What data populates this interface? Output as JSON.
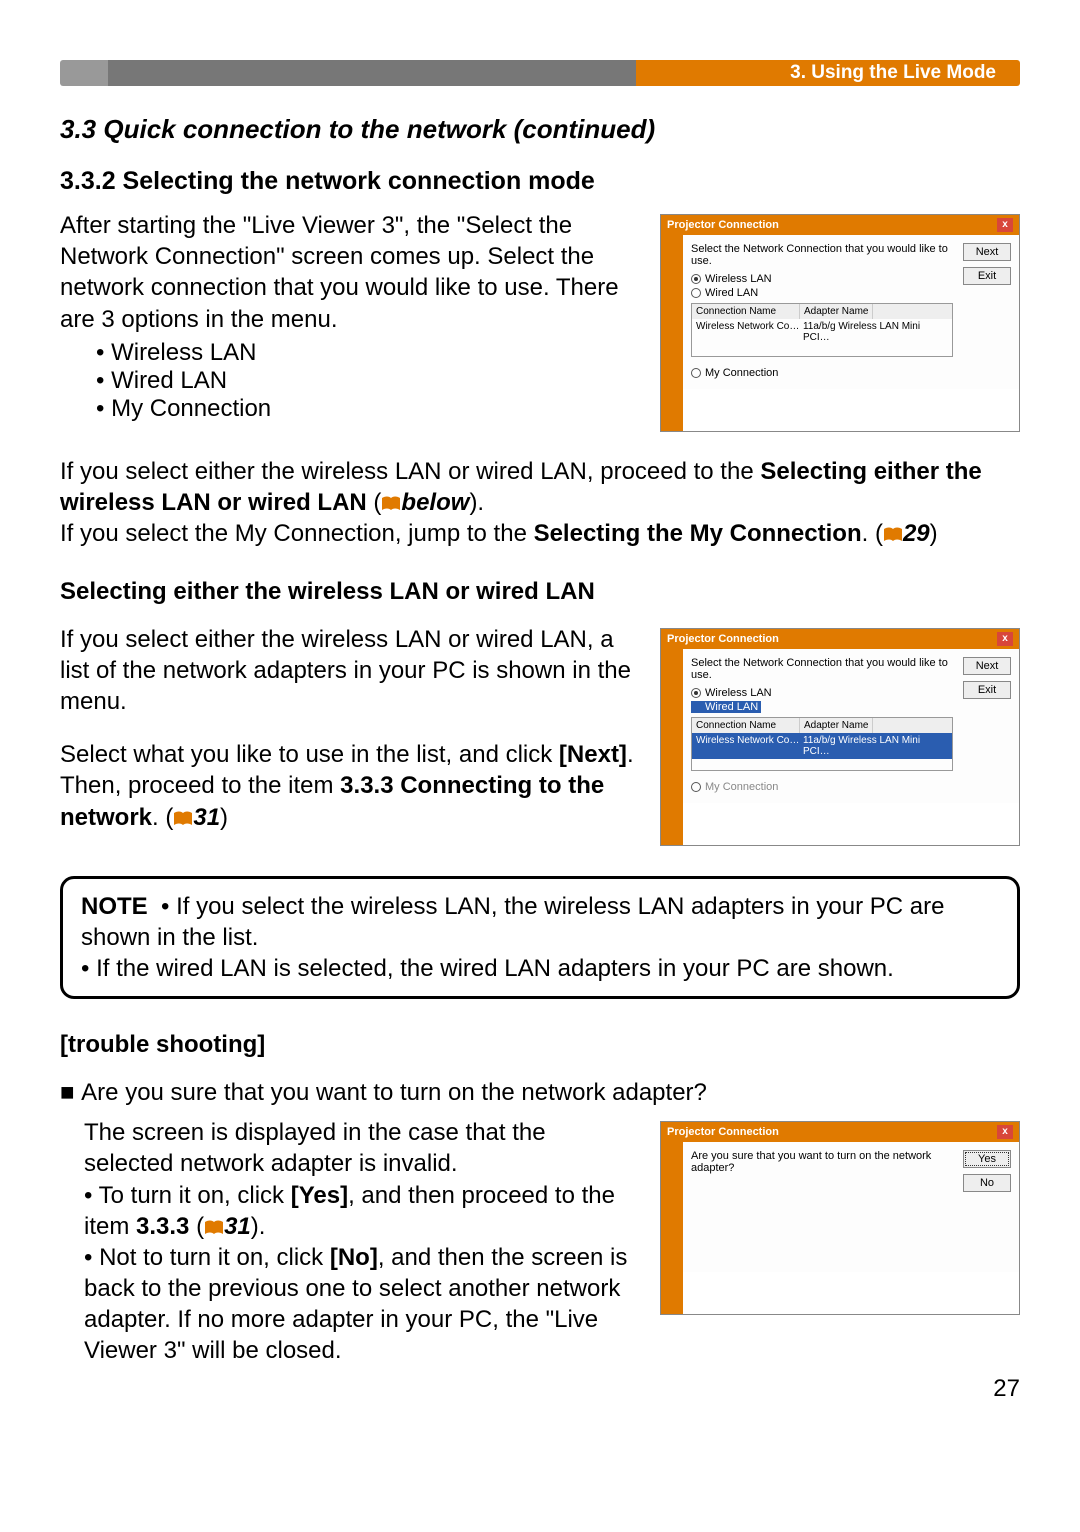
{
  "breadcrumb": "3. Using the Live Mode",
  "section": "3.3 Quick connection to the network (continued)",
  "subsection": "3.3.2 Selecting the network connection mode",
  "para1": "After starting the \"Live Viewer 3\", the \"Select the Network Connection\" screen comes up. Select the network connection that you would like to use. There are 3 options in the menu.",
  "options": [
    "Wireless LAN",
    "Wired LAN",
    "My Connection"
  ],
  "cross1a": "If you select either the wireless LAN or wired LAN, proceed to the ",
  "cross1b": "Selecting either the wireless LAN or wired LAN",
  "cross1c": "below",
  "cross2a": "If you select the My Connection, jump to the ",
  "cross2b": "Selecting the My Connection",
  "cross2c": "29",
  "sub2": "Selecting either the wireless LAN or wired LAN",
  "para2": "If you select either the wireless LAN or wired LAN, a list of the network adapters in your PC is shown in the menu.",
  "para3a": "Select what you like to use in the list, and click ",
  "para3b": "[Next]",
  "para3c": ".",
  "para4a": "Then, proceed to the item ",
  "para4b": "3.3.3 Connecting to the network",
  "para4c": "31",
  "note_label": "NOTE",
  "note1": "If you select the wireless LAN, the wireless LAN adapters in your PC are shown in the list.",
  "note2": "If the wired LAN is selected, the wired LAN adapters in your PC are shown.",
  "ts_heading": "[trouble shooting]",
  "ts_q": "Are you sure that you want to turn on the network adapter?",
  "ts_p1": "The screen is displayed in the case that the selected network adapter is invalid.",
  "ts_b1a": "To turn it on, click ",
  "ts_b1b": "[Yes]",
  "ts_b1c": ", and then proceed to the item ",
  "ts_b1d": "3.3.3",
  "ts_b1e": "31",
  "ts_b2a": "Not to turn it on, click ",
  "ts_b2b": "[No]",
  "ts_b2c": ", and then the screen is back to the previous one to select another network adapter. If no more adapter in your PC, the \"Live Viewer 3\" will be closed.",
  "page_number": "27",
  "dialog": {
    "title": "Projector Connection",
    "msg": "Select the Network Connection that you would like to use.",
    "radio1": "Wireless LAN",
    "radio2": "Wired LAN",
    "radio3": "My Connection",
    "col1": "Connection Name",
    "col2": "Adapter Name",
    "row_c1": "Wireless Network Co…",
    "row_c2": "11a/b/g Wireless LAN Mini PCI…",
    "next": "Next",
    "exit": "Exit",
    "ts_msg": "Are you sure that you want to turn on the network adapter?",
    "yes": "Yes",
    "no": "No"
  }
}
